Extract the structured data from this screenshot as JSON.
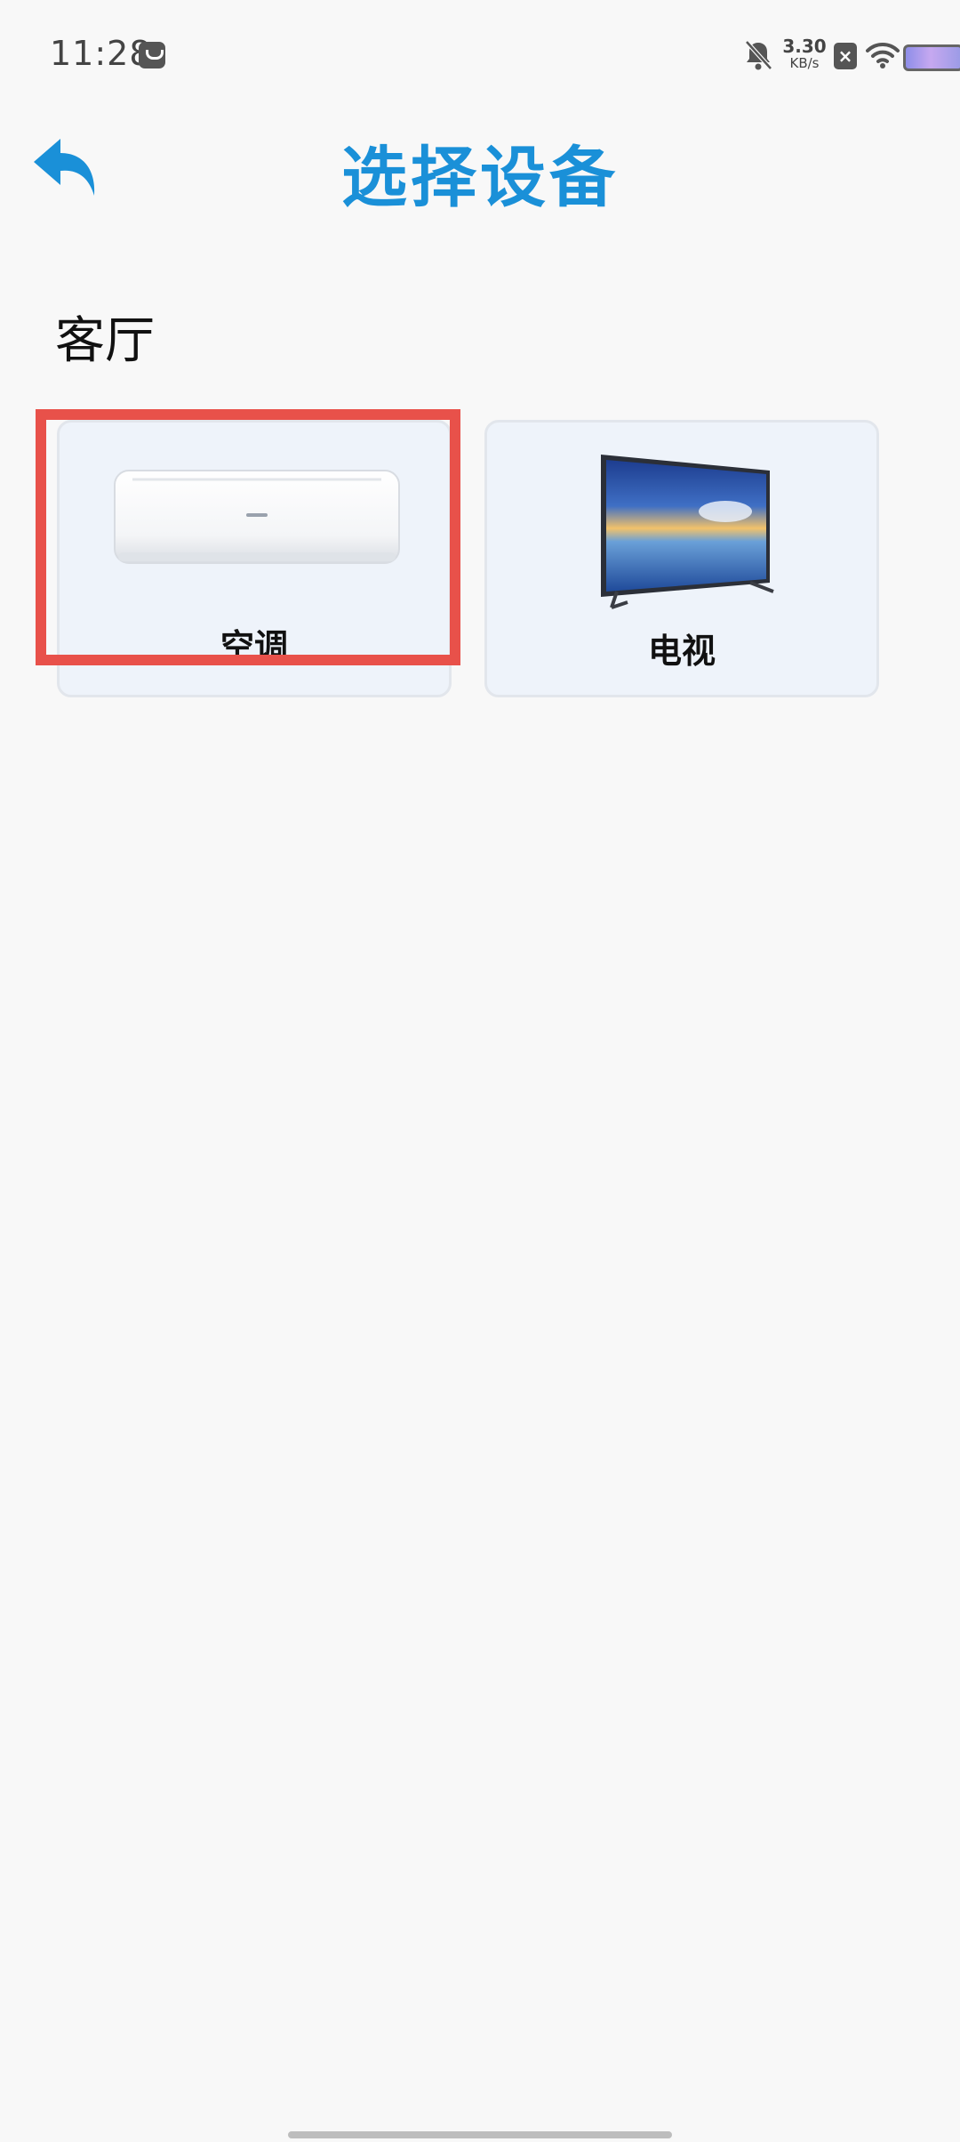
{
  "status_bar": {
    "time": "11:28",
    "net_speed_value": "3.30",
    "net_speed_unit": "KB/s",
    "icons": [
      "app-notification-icon",
      "bell-off-icon",
      "sim-x-icon",
      "wifi-icon",
      "battery-icon"
    ]
  },
  "header": {
    "title": "选择设备",
    "back_icon": "back-arrow-icon"
  },
  "section": {
    "title": "客厅"
  },
  "devices": [
    {
      "label": "空调",
      "icon": "air-conditioner-image"
    },
    {
      "label": "电视",
      "icon": "television-image"
    }
  ],
  "colors": {
    "accent": "#1a90d8",
    "highlight": "#e8514a",
    "card_background": "#eef3fa",
    "page_background": "#f8f8f8"
  }
}
